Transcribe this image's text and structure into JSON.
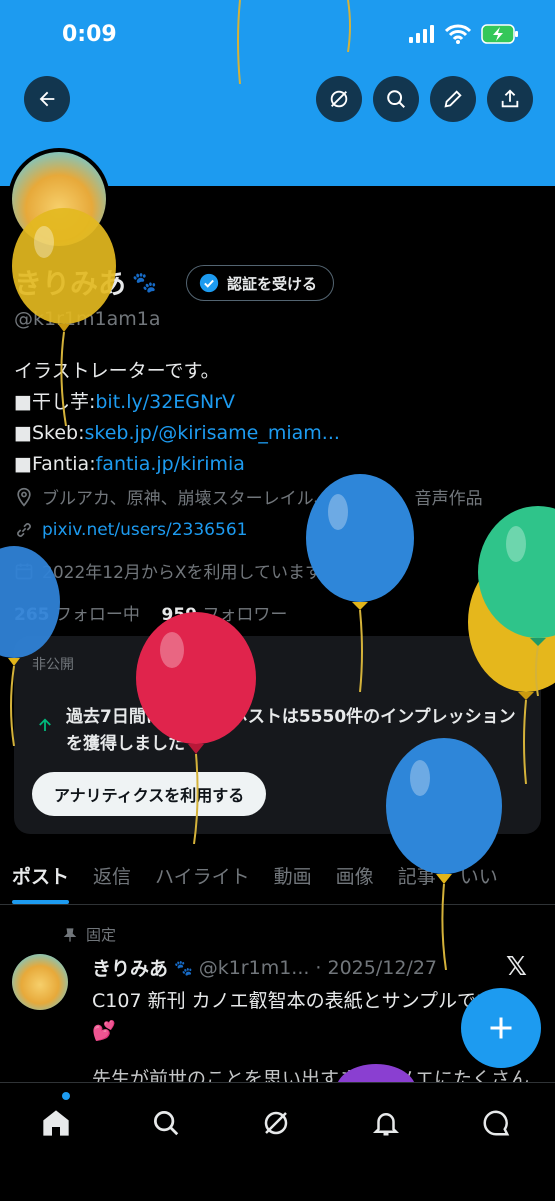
{
  "status_bar": {
    "time": "0:09"
  },
  "profile": {
    "name": "きりみあ",
    "name_emoji": "🐾",
    "verify_button": "認証を受ける",
    "handle": "@k1r1m1am1a",
    "bio": {
      "line1": "イラストレーターです。",
      "line2_prefix": "■干し芋:",
      "line2_link": "bit.ly/32EGNrV",
      "line3_prefix": "■Skeb:",
      "line3_link": "skeb.jp/@kirisame_miam...",
      "line4_prefix": "■Fantia:",
      "line4_link": "fantia.jp/kirimia"
    },
    "category": "ブルアカ、原神、崩壊スターレイル、アズレン、音声作品",
    "website": "pixiv.net/users/2336561",
    "joined": "2022年12月からXを利用しています",
    "following_count": "265",
    "following_label": "フォロー中",
    "followers_count": "959",
    "followers_label": "フォロワー"
  },
  "analytics_card": {
    "label": "非公開",
    "text": "過去7日間にあなたのポストは5550件のインプレッションを獲得しました",
    "button": "アナリティクスを利用する"
  },
  "tabs": [
    "ポスト",
    "返信",
    "ハイライト",
    "動画",
    "画像",
    "記事",
    "いい"
  ],
  "pinned_post": {
    "pinned_label": "固定",
    "name": "きりみあ",
    "name_emoji": "🐾",
    "handle": "@k1r1m1...",
    "date": "· 2025/12/27",
    "text": "C107 新刊 カノエ叡智本の表紙とサンプルです",
    "emoji": "💕",
    "text2": "先生が前世のことを思い出すまでカノエにたくさん"
  },
  "colors": {
    "accent": "#1d9bf0",
    "background": "#000000",
    "card": "#16181c",
    "muted": "#71767b"
  },
  "icons": {
    "back": "arrow-left-icon",
    "grok": "grok-icon",
    "search": "search-icon",
    "edit": "pencil-icon",
    "share": "share-icon",
    "verified": "verified-badge-icon",
    "location": "location-icon",
    "link": "link-icon",
    "calendar": "calendar-icon",
    "pin": "pin-icon",
    "compose": "plus-icon",
    "nav": [
      "home-icon",
      "search-icon",
      "grok-icon",
      "bell-icon",
      "message-icon"
    ]
  }
}
